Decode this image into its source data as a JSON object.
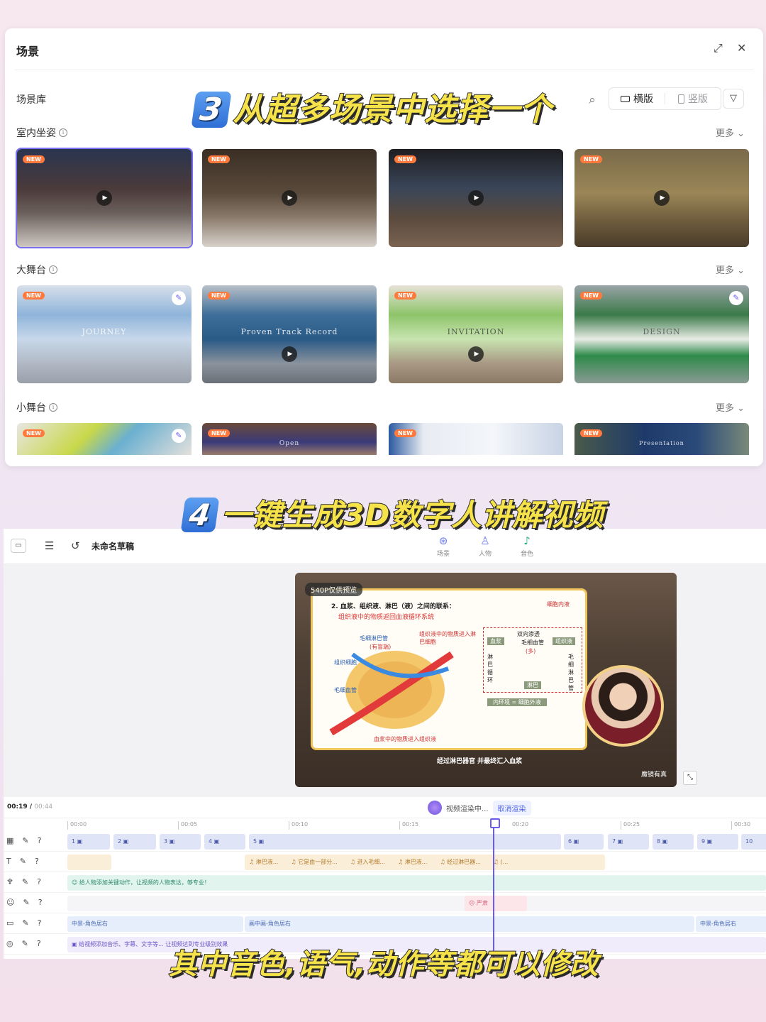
{
  "scene_panel": {
    "title": "场景",
    "library_label": "场景库",
    "orientation": {
      "landscape": "横版",
      "portrait": "竖版"
    },
    "more_label": "更多",
    "sections": [
      {
        "label": "室内坐姿",
        "cards": [
          {
            "badge": "NEW",
            "text": "",
            "selected": true
          },
          {
            "badge": "NEW",
            "text": ""
          },
          {
            "badge": "NEW",
            "text": ""
          },
          {
            "badge": "NEW",
            "text": ""
          }
        ]
      },
      {
        "label": "大舞台",
        "cards": [
          {
            "badge": "NEW",
            "text": "JOURNEY"
          },
          {
            "badge": "NEW",
            "text": "Proven Track Record"
          },
          {
            "badge": "NEW",
            "text": "INVITATION"
          },
          {
            "badge": "NEW",
            "text": "DESIGN"
          }
        ]
      },
      {
        "label": "小舞台",
        "cards": [
          {
            "badge": "NEW",
            "text": ""
          },
          {
            "badge": "NEW",
            "text": "Open"
          },
          {
            "badge": "NEW",
            "text": ""
          },
          {
            "badge": "NEW",
            "text": "Presentation"
          }
        ]
      }
    ]
  },
  "overlays": {
    "step3_num": "3",
    "step3_text": "从超多场景中选择一个",
    "step4_num": "4",
    "step4_text": "一键生成3D数字人讲解视频",
    "bottom_text": "其中音色,语气,动作等都可以修改"
  },
  "editor": {
    "draft_title": "未命名草稿",
    "tabs": [
      "场景",
      "人物",
      "音色"
    ],
    "preview": {
      "badge": "540P仅供预览",
      "slide_heading": "2. 血浆、组织液、淋巴（液）之间的联系：",
      "slide_sub": "组织液中的物质返回血液循环系统",
      "labels": [
        "毛细淋巴管",
        "(有盲端)",
        "组织液中的物质进入淋巴细胞",
        "组织细胞",
        "毛细血管",
        "血浆中的物质进入组织液",
        "细胞内液",
        "双向渗透",
        "毛细血管",
        "(多)",
        "血浆",
        "组织液",
        "淋巴循环",
        "毛细淋巴管",
        "淋巴",
        "内环境 = 细胞外液"
      ],
      "caption": "经过淋巴器官 并最终汇入血浆",
      "footer": "魔镜有真"
    },
    "time_current": "00:19",
    "time_total": "00:44",
    "render_status": "视频渲染中...",
    "cancel_label": "取消渲染",
    "ruler": [
      "00:00",
      "00:05",
      "00:10",
      "00:15",
      "00:20",
      "00:25",
      "00:30"
    ],
    "scene_segments": [
      "1",
      "2",
      "3",
      "4",
      "5",
      "6",
      "7",
      "8",
      "9",
      "10"
    ],
    "audio_segments": [
      "淋巴液...",
      "它是由一部分...",
      "进入毛细...",
      "淋巴液...",
      "经过淋巴器...",
      "(..."
    ],
    "action_hint": "给人物添加关键动作，让视频的人物表达，够专业！",
    "face_segment": "严肃",
    "camera_segments": [
      "中景-角色居右",
      "画中画-角色居右",
      "中景-角色居右"
    ],
    "music_hint": "给视频添加音乐、字幕、文字等... 让视频达到专业级别效果"
  }
}
